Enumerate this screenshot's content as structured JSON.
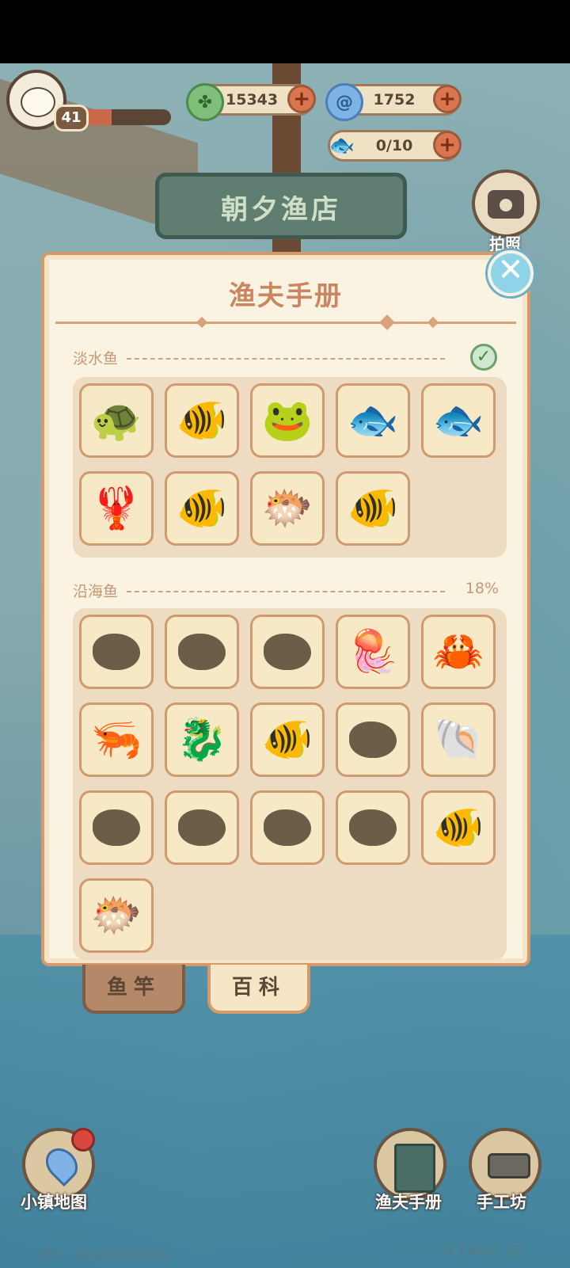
{
  "hud": {
    "level": "41",
    "xp_fraction": 0.35,
    "clover_value": "15343",
    "shell_value": "1752",
    "fish_capacity": "0/10",
    "shop_sign": "朝夕渔店",
    "camera_label": "拍照"
  },
  "panel": {
    "title": "渔夫手册",
    "freshwater": {
      "name": "淡水鱼",
      "complete": true,
      "items": [
        {
          "name": "turtle",
          "glyph": "🐢",
          "collected": true
        },
        {
          "name": "goldfish",
          "glyph": "🐠",
          "collected": true
        },
        {
          "name": "frog",
          "glyph": "🐸",
          "collected": true
        },
        {
          "name": "koi",
          "glyph": "🐟",
          "collected": true
        },
        {
          "name": "carp",
          "glyph": "🐟",
          "collected": true
        },
        {
          "name": "crayfish",
          "glyph": "🦞",
          "collected": true
        },
        {
          "name": "angelfish",
          "glyph": "🐠",
          "collected": true
        },
        {
          "name": "piranha",
          "glyph": "🐡",
          "collected": true
        },
        {
          "name": "betta",
          "glyph": "🐠",
          "collected": true
        }
      ]
    },
    "coastal": {
      "name": "沿海鱼",
      "percent": "18%",
      "items": [
        {
          "name": "fish-silhouette",
          "glyph": "",
          "collected": false
        },
        {
          "name": "fish-silhouette",
          "glyph": "",
          "collected": false
        },
        {
          "name": "shell-silhouette",
          "glyph": "",
          "collected": false
        },
        {
          "name": "jellyfish",
          "glyph": "🪼",
          "collected": true
        },
        {
          "name": "crab",
          "glyph": "🦀",
          "collected": true
        },
        {
          "name": "shrimp",
          "glyph": "🦐",
          "collected": true
        },
        {
          "name": "seahorse",
          "glyph": "🐉",
          "collected": true
        },
        {
          "name": "clownfish",
          "glyph": "🐠",
          "collected": true
        },
        {
          "name": "oyster-silhouette",
          "glyph": "",
          "collected": false
        },
        {
          "name": "conch",
          "glyph": "🐚",
          "collected": true
        },
        {
          "name": "sea-cucumber-silhouette",
          "glyph": "",
          "collected": false
        },
        {
          "name": "starfish-silhouette",
          "glyph": "",
          "collected": false
        },
        {
          "name": "sunfish-silhouette",
          "glyph": "",
          "collected": false
        },
        {
          "name": "angelfish-silhouette",
          "glyph": "",
          "collected": false
        },
        {
          "name": "striped-fish",
          "glyph": "🐠",
          "collected": true
        },
        {
          "name": "scorpionfish",
          "glyph": "🐡",
          "collected": true
        }
      ]
    }
  },
  "tabs": {
    "rod": "鱼竿",
    "encyclopedia": "百科"
  },
  "nav": {
    "map": "小镇地图",
    "handbook": "渔夫手册",
    "workshop": "手工坊"
  },
  "footer": {
    "id": "ID： nwsxUKfpGjsV",
    "version": "V.3.40.0_12"
  }
}
